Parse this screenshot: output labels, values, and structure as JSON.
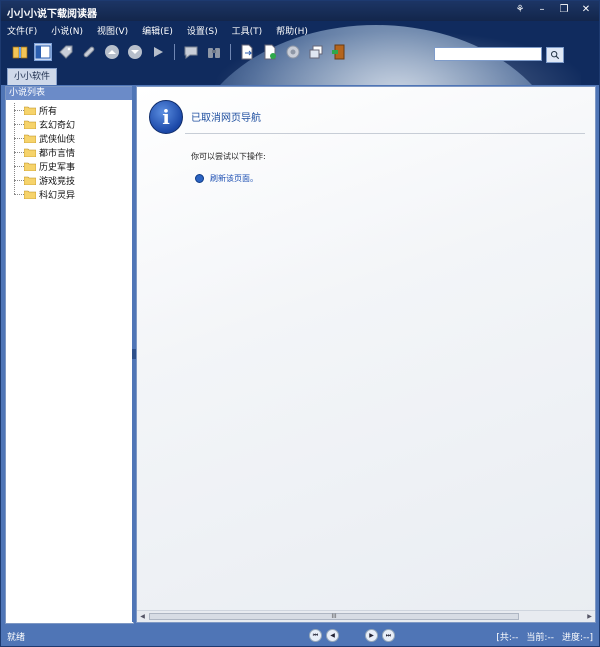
{
  "window": {
    "title": "小小小说下载阅读器"
  },
  "menu": [
    "文件(F)",
    "小说(N)",
    "视图(V)",
    "编辑(E)",
    "设置(S)",
    "工具(T)",
    "帮助(H)"
  ],
  "toolbar_icons": [
    "book-open-icon",
    "layout-panel-icon",
    "tag-icon",
    "link-icon",
    "arrow-up-circle-icon",
    "arrow-down-circle-icon",
    "play-icon",
    "comment-icon",
    "binoculars-icon",
    "doc-export-icon",
    "doc-add-icon",
    "gear-icon",
    "window-restore-icon",
    "exit-door-icon"
  ],
  "search": {
    "value": "",
    "placeholder": ""
  },
  "tab": {
    "label": "小小软件"
  },
  "left_panel": {
    "title": "小说列表",
    "items": [
      "所有",
      "玄幻奇幻",
      "武侠仙侠",
      "都市言情",
      "历史军事",
      "游戏竞技",
      "科幻灵异"
    ]
  },
  "content": {
    "title": "已取消网页导航",
    "subtitle": "你可以尝试以下操作:",
    "action": "刷新该页面。"
  },
  "scrollbar": {
    "thumb": "III"
  },
  "status": {
    "left": "就绪",
    "total": "[共:--",
    "current": "当前:--",
    "progress": "进度:--]"
  },
  "colors": {
    "accent": "#4f75b6",
    "title_blue": "#1f4fa0",
    "link_blue": "#1d4fb3"
  }
}
